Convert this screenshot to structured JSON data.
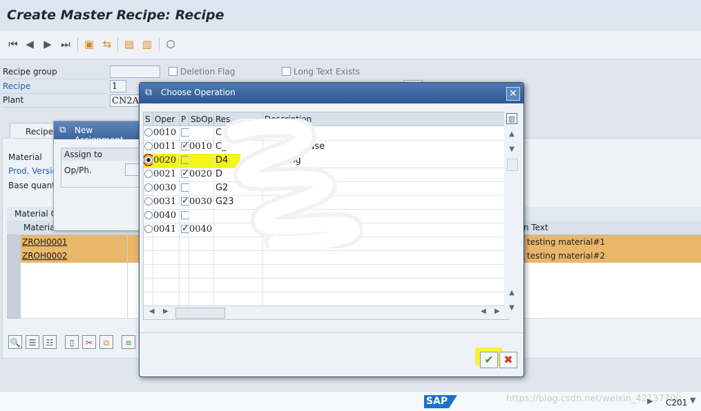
{
  "window": {
    "title": "Create Master Recipe: Recipe"
  },
  "toolbar": {
    "icons": [
      "first-page-icon",
      "previous-page-icon",
      "next-page-icon",
      "last-page-icon",
      "header-icon",
      "assign-icon",
      "operations-icon",
      "material-list-icon",
      "check-icon"
    ]
  },
  "header": {
    "recipe_group_label": "Recipe group",
    "recipe_group_value": "",
    "deletion_flag_label": "Deletion Flag",
    "long_text_label": "Long Text Exists",
    "recipe_label": "Recipe",
    "recipe_value": "1",
    "plant_label": "Plant",
    "plant_value": "CN2A"
  },
  "tabs": {
    "recipe": "Recipe"
  },
  "main": {
    "material_label": "Material",
    "prod_version_label": "Prod. Versio",
    "base_qty_label": "Base quantit",
    "material_comp_label": "Material C",
    "col_material": "Material",
    "col_short_text": "n Text",
    "rows": [
      {
        "material": "ZROH0001",
        "text": "testing material#1"
      },
      {
        "material": "ZROH0002",
        "text": "testing material#2"
      }
    ]
  },
  "new_assignment": {
    "title": "New Assignment",
    "assign_to": "Assign to",
    "op_ph": "Op/Ph."
  },
  "choose_operation": {
    "title": "Choose Operation",
    "columns": [
      "S",
      "Oper",
      "P",
      "SbOp",
      "Res.",
      "Description"
    ],
    "rows": [
      {
        "selected": false,
        "oper": "0010",
        "p": false,
        "sbop": "",
        "res": "C",
        "desc": ""
      },
      {
        "selected": false,
        "oper": "0011",
        "p": true,
        "sbop": "0010",
        "res": "C_",
        "desc": "phase"
      },
      {
        "selected": true,
        "oper": "0020",
        "p": false,
        "sbop": "",
        "res": "D4",
        "desc": "sing"
      },
      {
        "selected": false,
        "oper": "0021",
        "p": true,
        "sbop": "0020",
        "res": "D",
        "desc": ""
      },
      {
        "selected": false,
        "oper": "0030",
        "p": false,
        "sbop": "",
        "res": "G2",
        "desc": ""
      },
      {
        "selected": false,
        "oper": "0031",
        "p": true,
        "sbop": "0030",
        "res": "G23",
        "desc": "s"
      },
      {
        "selected": false,
        "oper": "0040",
        "p": false,
        "sbop": "",
        "res": "",
        "desc": ""
      },
      {
        "selected": false,
        "oper": "0041",
        "p": true,
        "sbop": "0040",
        "res": "",
        "desc": ""
      }
    ],
    "ok_label": "✔",
    "cancel_label": "✖"
  },
  "status": {
    "brand": "SAP",
    "watermark": "https://blog.csdn.net/weixin_42137700",
    "system": "C201"
  },
  "colors": {
    "highlight": "#f4f41a",
    "row_orange": "#e9b76a",
    "dialog_header": "#3d659b",
    "selection_box": "#d12b2b"
  }
}
